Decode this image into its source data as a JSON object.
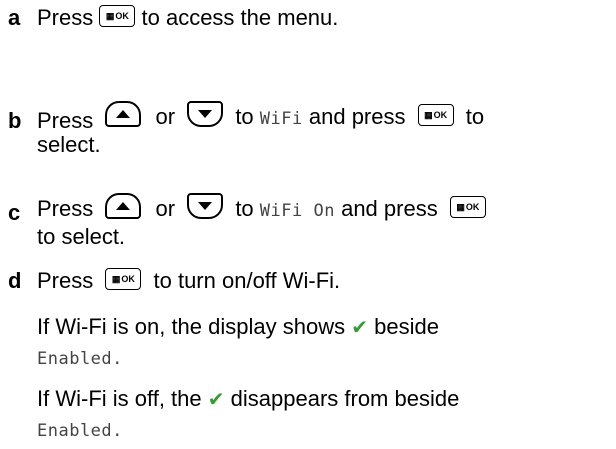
{
  "steps": [
    {
      "letter": "a",
      "parts": [
        "Press",
        "to access the menu."
      ]
    },
    {
      "letter": "b",
      "parts": [
        "Press",
        "or",
        "to",
        "WiFi",
        "and press",
        "to",
        "select."
      ]
    },
    {
      "letter": "c",
      "parts": [
        "Press",
        "or",
        "to",
        "WiFi On",
        "and press",
        "to select."
      ]
    },
    {
      "letter": "d",
      "parts": [
        "Press",
        "to turn on/off Wi-Fi."
      ],
      "note1": [
        "If Wi-Fi is on, the display shows",
        "beside",
        "Enabled."
      ],
      "note2": [
        "If Wi-Fi is off, the",
        "disappears from beside",
        "Enabled."
      ]
    }
  ],
  "keys": {
    "ok_label": "OK",
    "menu_glyph": "▦"
  },
  "icons": {
    "check": "✔",
    "check_color": "#3a9a3a"
  }
}
